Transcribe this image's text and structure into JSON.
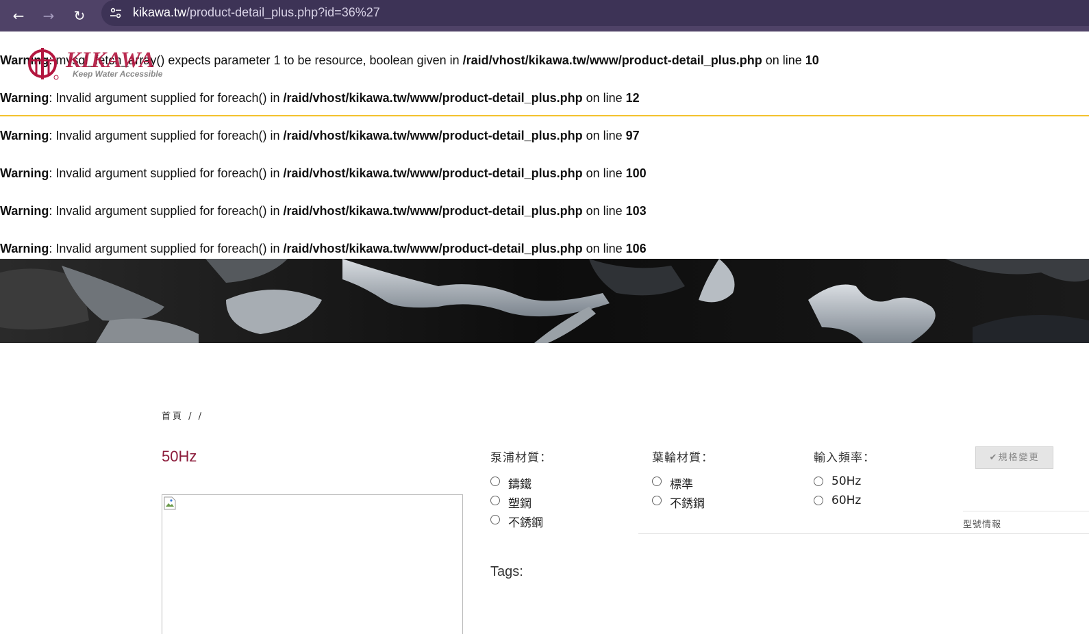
{
  "browser": {
    "back_icon": "←",
    "forward_icon": "→",
    "reload_icon": "↻",
    "site_info_icon": "⚙",
    "url_host": "kikawa.tw",
    "url_path": "/product-detail_plus.php?id=36%27"
  },
  "logo": {
    "word": "KIKAWA",
    "tagline": "Keep Water Accessible"
  },
  "warnings": [
    {
      "label": "Warning",
      "message": ": mysql_fetch_array() expects parameter 1 to be resource, boolean given in ",
      "file": "/raid/vhost/kikawa.tw/www/product-detail_plus.php",
      "on_line": " on line ",
      "line": "10"
    },
    {
      "label": "Warning",
      "message": ": Invalid argument supplied for foreach() in ",
      "file": "/raid/vhost/kikawa.tw/www/product-detail_plus.php",
      "on_line": " on line ",
      "line": "12"
    },
    {
      "label": "Warning",
      "message": ": Invalid argument supplied for foreach() in ",
      "file": "/raid/vhost/kikawa.tw/www/product-detail_plus.php",
      "on_line": " on line ",
      "line": "97"
    },
    {
      "label": "Warning",
      "message": ": Invalid argument supplied for foreach() in ",
      "file": "/raid/vhost/kikawa.tw/www/product-detail_plus.php",
      "on_line": " on line ",
      "line": "100"
    },
    {
      "label": "Warning",
      "message": ": Invalid argument supplied for foreach() in ",
      "file": "/raid/vhost/kikawa.tw/www/product-detail_plus.php",
      "on_line": " on line ",
      "line": "103"
    },
    {
      "label": "Warning",
      "message": ": Invalid argument supplied for foreach() in ",
      "file": "/raid/vhost/kikawa.tw/www/product-detail_plus.php",
      "on_line": " on line ",
      "line": "106"
    }
  ],
  "breadcrumb": "首頁 /  /",
  "product": {
    "title": "50Hz"
  },
  "options": {
    "pump_material": {
      "title": "泵浦材質：",
      "items": [
        "鑄鐵",
        "塑鋼",
        "不銹鋼"
      ]
    },
    "impeller_material": {
      "title": "葉輪材質：",
      "items": [
        "標準",
        "不銹鋼"
      ]
    },
    "frequency": {
      "title": "輸入頻率：",
      "items": [
        "50Hz",
        "60Hz"
      ]
    }
  },
  "spec_button": {
    "icon": "✔",
    "label": "規格變更"
  },
  "model_info": "型號情報",
  "tags_label": "Tags:",
  "colors": {
    "browser_bar": "#4f4267",
    "accent_red": "#b3163f",
    "title_color": "#8c1c3b",
    "yellow_rule": "#f3c22e"
  }
}
